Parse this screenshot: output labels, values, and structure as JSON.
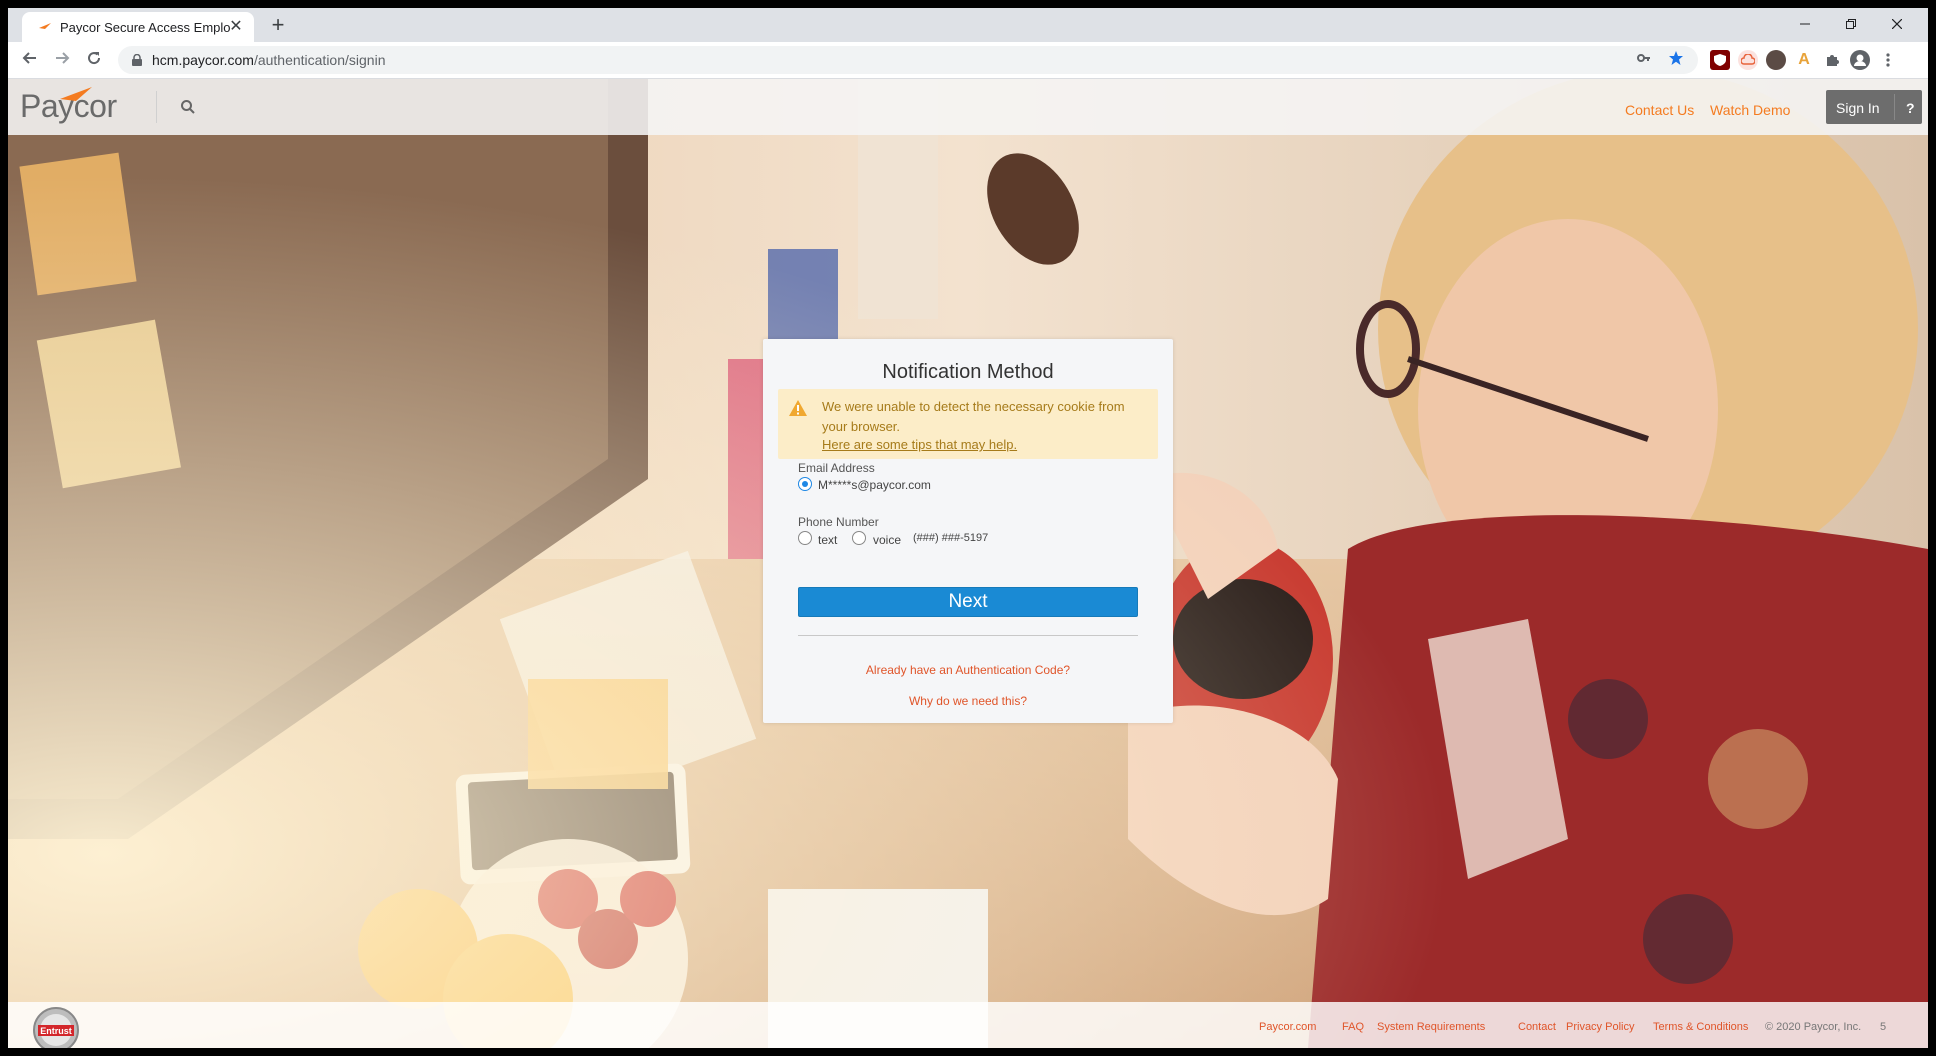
{
  "browser": {
    "tab_title": "Paycor Secure Access Employee",
    "tab_close": "✕",
    "new_tab": "+",
    "url_host": "hcm.paycor.com",
    "url_path": "/authentication/signin"
  },
  "site": {
    "logo_text": "Paycor",
    "nav": {
      "contact": "Contact Us",
      "demo": "Watch Demo",
      "signin": "Sign In",
      "help": "?"
    }
  },
  "card": {
    "title": "Notification Method",
    "alert": {
      "message": "We were unable to detect the necessary cookie from your browser.",
      "link": "Here are some tips that may help."
    },
    "email_label": "Email Address",
    "email_value": "M*****s@paycor.com",
    "phone_label": "Phone Number",
    "phone_options": [
      "text",
      "voice"
    ],
    "phone_value": "(###) ###-5197",
    "next_label": "Next",
    "auth_code_link": "Already have an Authentication Code?",
    "why_link": "Why do we need this?"
  },
  "footer": {
    "seal_text": "Entrust",
    "links": [
      "Paycor.com",
      "FAQ",
      "System Requirements",
      "Contact",
      "Privacy Policy",
      "Terms & Conditions"
    ],
    "copyright": "© 2020 Paycor, Inc.",
    "page": "5"
  },
  "colors": {
    "accent": "#f47b20",
    "link": "#e0552a",
    "button": "#1a8ad4",
    "alert_bg": "#fcedc8"
  }
}
